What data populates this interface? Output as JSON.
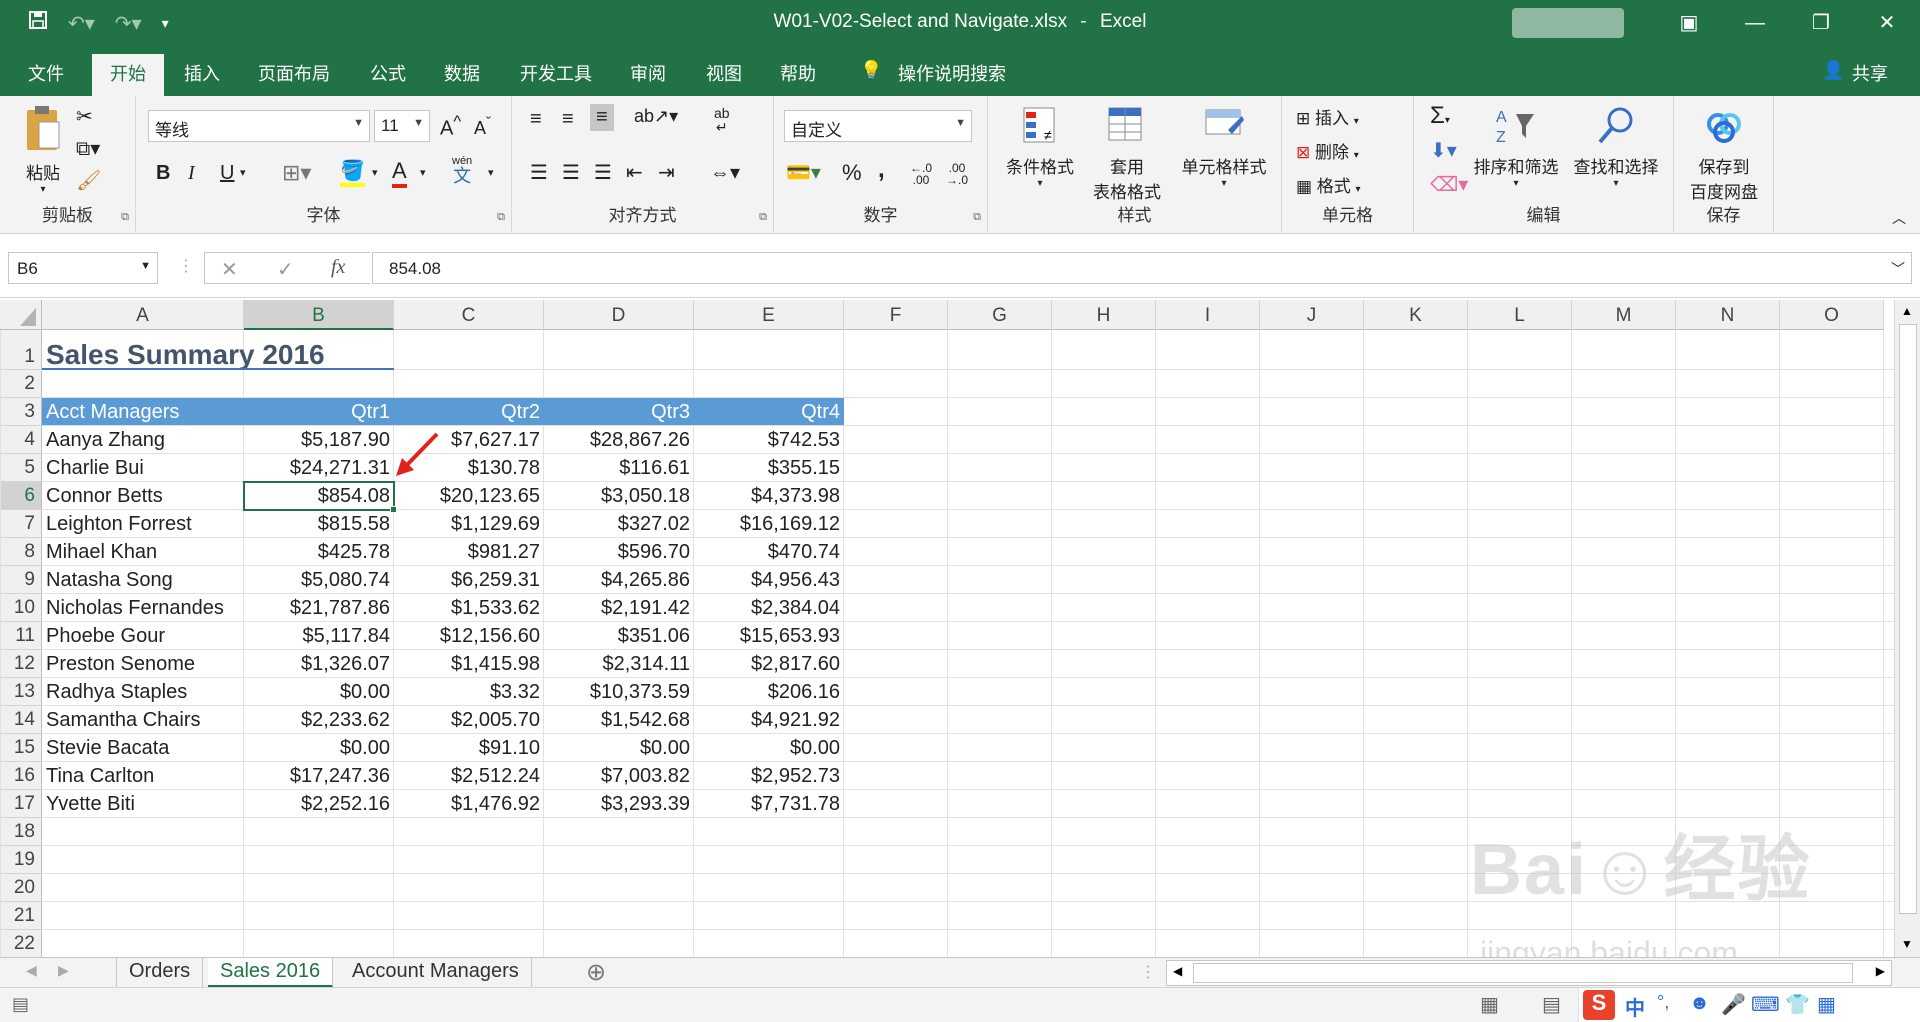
{
  "titlebar": {
    "filename": "W01-V02-Select and Navigate.xlsx",
    "app": "Excel",
    "separator": "-",
    "save_icon": "save-icon",
    "undo_icon": "undo-icon",
    "redo_icon": "redo-icon",
    "customize_icon": "customize-qat-icon",
    "minimize": "—",
    "restore": "❐",
    "close": "✕",
    "ribbon_display": "▣"
  },
  "tabs": {
    "file": "文件",
    "home": "开始",
    "insert": "插入",
    "layout": "页面布局",
    "formulas": "公式",
    "data": "数据",
    "developer": "开发工具",
    "review": "审阅",
    "view": "视图",
    "help": "帮助",
    "tell": "操作说明搜索",
    "share": "共享"
  },
  "ribbon": {
    "clipboard": {
      "label": "剪贴板",
      "paste": "粘贴"
    },
    "font": {
      "label": "字体",
      "name": "等线",
      "size": "11",
      "bold": "B",
      "italic": "I",
      "underline": "U",
      "wen": "wén",
      "wen_char": "文"
    },
    "alignment": {
      "label": "对齐方式"
    },
    "number": {
      "label": "数字",
      "format": "自定义",
      "percent": "%",
      "comma": ","
    },
    "styles": {
      "label": "样式",
      "conditional": "条件格式",
      "table_format_1": "套用",
      "table_format_2": "表格格式",
      "cell_styles": "单元格样式"
    },
    "cells": {
      "label": "单元格",
      "insert": "插入",
      "delete": "删除",
      "format": "格式"
    },
    "editing": {
      "label": "编辑",
      "sum": "Σ",
      "sort": "排序和筛选",
      "find": "查找和选择"
    },
    "save": {
      "label": "保存",
      "save_1": "保存到",
      "save_2": "百度网盘"
    }
  },
  "formulabar": {
    "namebox": "B6",
    "value": "854.08",
    "cancel": "✕",
    "enter": "✓",
    "fx": "fx"
  },
  "columns": [
    "A",
    "B",
    "C",
    "D",
    "E",
    "F",
    "G",
    "H",
    "I",
    "J",
    "K",
    "L",
    "M",
    "N",
    "O"
  ],
  "rows": [
    "1",
    "2",
    "3",
    "4",
    "5",
    "6",
    "7",
    "8",
    "9",
    "10",
    "11",
    "12",
    "13",
    "14",
    "15",
    "16",
    "17",
    "18",
    "19",
    "20",
    "21",
    "22"
  ],
  "sheet": {
    "title": "Sales Summary 2016",
    "headers": [
      "Acct Managers",
      "Qtr1",
      "Qtr2",
      "Qtr3",
      "Qtr4"
    ],
    "data": [
      [
        "Aanya Zhang",
        "$5,187.90",
        "$7,627.17",
        "$28,867.26",
        "$742.53"
      ],
      [
        "Charlie Bui",
        "$24,271.31",
        "$130.78",
        "$116.61",
        "$355.15"
      ],
      [
        "Connor Betts",
        "$854.08",
        "$20,123.65",
        "$3,050.18",
        "$4,373.98"
      ],
      [
        "Leighton Forrest",
        "$815.58",
        "$1,129.69",
        "$327.02",
        "$16,169.12"
      ],
      [
        "Mihael Khan",
        "$425.78",
        "$981.27",
        "$596.70",
        "$470.74"
      ],
      [
        "Natasha Song",
        "$5,080.74",
        "$6,259.31",
        "$4,265.86",
        "$4,956.43"
      ],
      [
        "Nicholas Fernandes",
        "$21,787.86",
        "$1,533.62",
        "$2,191.42",
        "$2,384.04"
      ],
      [
        "Phoebe Gour",
        "$5,117.84",
        "$12,156.60",
        "$351.06",
        "$15,653.93"
      ],
      [
        "Preston Senome",
        "$1,326.07",
        "$1,415.98",
        "$2,314.11",
        "$2,817.60"
      ],
      [
        "Radhya Staples",
        "$0.00",
        "$3.32",
        "$10,373.59",
        "$206.16"
      ],
      [
        "Samantha Chairs",
        "$2,233.62",
        "$2,005.70",
        "$1,542.68",
        "$4,921.92"
      ],
      [
        "Stevie Bacata",
        "$0.00",
        "$91.10",
        "$0.00",
        "$0.00"
      ],
      [
        "Tina Carlton",
        "$17,247.36",
        "$2,512.24",
        "$7,003.82",
        "$2,952.73"
      ],
      [
        "Yvette Biti",
        "$2,252.16",
        "$1,476.92",
        "$3,293.39",
        "$7,731.78"
      ]
    ]
  },
  "sheettabs": {
    "orders": "Orders",
    "sales": "Sales 2016",
    "managers": "Account Managers",
    "add": "⊕"
  },
  "watermark": {
    "main": "Bai☺经验",
    "sub": "jingyan.baidu.com"
  },
  "ime": {
    "zh": "中",
    "punct": "°,",
    "brand": "S"
  },
  "colors": {
    "excel_green": "#217346",
    "header_blue": "#5b9bd5",
    "title_blue": "#44546a",
    "arrow_red": "#e2231a"
  }
}
